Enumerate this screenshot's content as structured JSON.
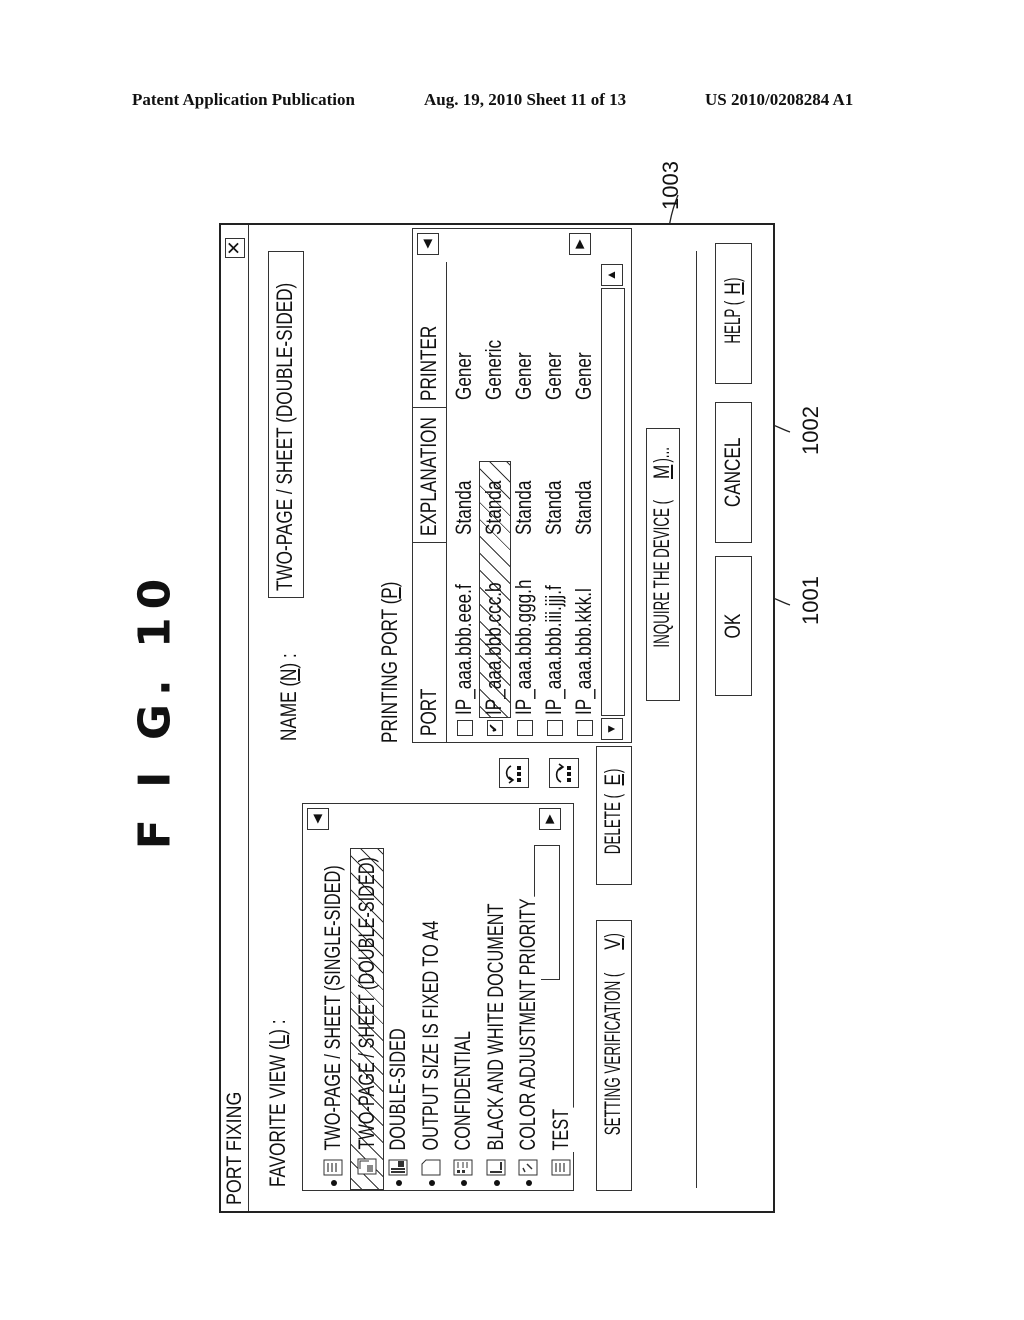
{
  "header": {
    "publication": "Patent Application Publication",
    "date_sheet": "Aug. 19, 2010  Sheet 11 of 13",
    "patent_number": "US 2010/0208284 A1"
  },
  "figure": {
    "title": "F I G. 10"
  },
  "dialog": {
    "title": "PORT FIXING",
    "close_icon": "close-x-icon",
    "favorite_view": {
      "label_prefix": "FAVORITE VIEW (",
      "mnemonic": "L",
      "label_suffix": ") :",
      "items": [
        {
          "label": "TWO-PAGE / SHEET (SINGLE-SIDED)",
          "icon": "grid-document-icon",
          "bullet": true,
          "selected": false
        },
        {
          "label": "TWO-PAGE / SHEET (DOUBLE-SIDED)",
          "icon": "double-document-icon",
          "bullet": false,
          "selected": true
        },
        {
          "label": "DOUBLE-SIDED",
          "icon": "duplex-document-icon",
          "bullet": true,
          "selected": false
        },
        {
          "label": "OUTPUT SIZE IS FIXED TO A4",
          "icon": "blank-page-icon",
          "bullet": true,
          "selected": false
        },
        {
          "label": "CONFIDENTIAL",
          "icon": "confidential-document-icon",
          "bullet": true,
          "selected": false
        },
        {
          "label": "BLACK AND WHITE DOCUMENT",
          "icon": "bw-document-icon",
          "bullet": true,
          "selected": false
        },
        {
          "label": "COLOR ADJUSTMENT PRIORITY",
          "icon": "color-adjust-icon",
          "bullet": true,
          "selected": false
        },
        {
          "label": "TEST",
          "icon": "grid-document-icon",
          "bullet": false,
          "selected": false
        }
      ],
      "scroll_left": "◀",
      "scroll_right": "▶"
    },
    "name": {
      "label_prefix": "NAME (",
      "mnemonic": "N",
      "label_suffix": ") :",
      "value": "TWO-PAGE / SHEET (DOUBLE-SIDED)"
    },
    "printing_port": {
      "label_prefix": "PRINTING PORT (",
      "mnemonic": "P",
      "label_suffix": ")",
      "columns": [
        "PORT",
        "EXPLANATION",
        "PRINTER"
      ],
      "rows": [
        {
          "checked": false,
          "port": "IP_aaa.bbb.eee.f",
          "explanation": "Standa",
          "printer": "Gener",
          "selected": false
        },
        {
          "checked": true,
          "port": "IP_aaa.bbb.ccc.b",
          "explanation": "Standa",
          "printer": "Generic",
          "selected": true
        },
        {
          "checked": false,
          "port": "IP_aaa.bbb.ggg.h",
          "explanation": "Standa",
          "printer": "Gener",
          "selected": false
        },
        {
          "checked": false,
          "port": "IP_aaa.bbb.iii.jjj.f",
          "explanation": "Standa",
          "printer": "Gener",
          "selected": false
        },
        {
          "checked": false,
          "port": "IP_aaa.bbb.kkk.l",
          "explanation": "Standa",
          "printer": "Gener",
          "selected": false
        }
      ],
      "check_mark": "✔",
      "scroll_left": "◀",
      "scroll_right": "▶",
      "scroll_up": "▲",
      "scroll_down": "▼"
    },
    "buttons": {
      "move_up_icon": "↶",
      "move_down_icon": "↷",
      "delete_prefix": "DELETE (",
      "delete_mnemonic": "E",
      "delete_suffix": ")",
      "setting_verification_prefix": "SETTING VERIFICATION (",
      "setting_verification_mnemonic": "V",
      "setting_verification_suffix": ")",
      "inquire_prefix": "INQUIRE THE DEVICE (",
      "inquire_mnemonic": "M",
      "inquire_suffix": ")...",
      "ok": "OK",
      "cancel": "CANCEL",
      "help_prefix": "HELP (",
      "help_mnemonic": "H",
      "help_suffix": ")"
    }
  },
  "reference_numerals": {
    "ok": "1001",
    "cancel": "1002",
    "inquire": "1003"
  }
}
